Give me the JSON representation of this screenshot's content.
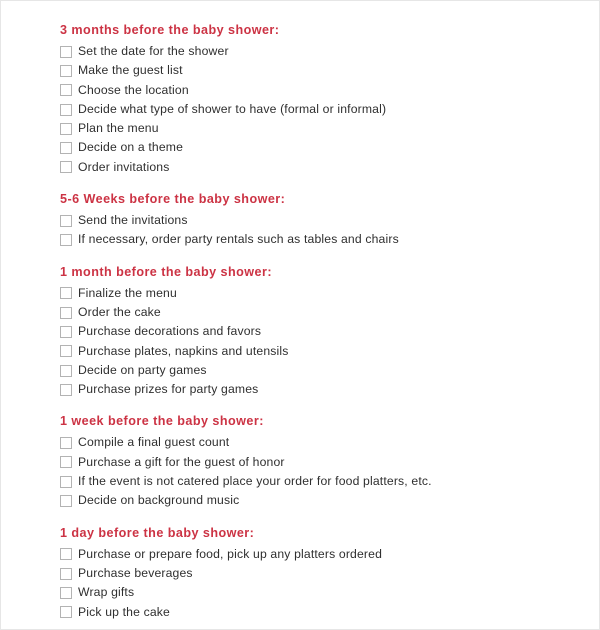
{
  "document": {
    "type": "baby-shower-planning-checklist",
    "accent_color": "#cc3344",
    "text_color": "#2f2f2f",
    "checkbox_border_color": "#b3b3b3",
    "page_border_color": "#e6e6e6",
    "background_color": "#ffffff"
  },
  "sections": [
    {
      "heading": "3 months before the baby shower:",
      "items": [
        "Set the date for the shower",
        "Make the guest list",
        "Choose the location",
        "Decide what type of shower to have (formal or informal)",
        "Plan the menu",
        "Decide on a theme",
        "Order invitations"
      ]
    },
    {
      "heading": "5-6 Weeks before the baby shower:",
      "items": [
        "Send the invitations",
        "If necessary, order party rentals such as tables and chairs"
      ]
    },
    {
      "heading": "1 month before the baby shower:",
      "items": [
        "Finalize the menu",
        "Order the cake",
        "Purchase decorations and favors",
        "Purchase plates, napkins and utensils",
        "Decide on party games",
        "Purchase prizes for party games"
      ]
    },
    {
      "heading": "1 week before the baby shower:",
      "items": [
        "Compile a final guest count",
        "Purchase a gift for the guest of honor",
        "If the event is not catered place your order for food platters, etc.",
        "Decide on background music"
      ]
    },
    {
      "heading": "1 day before the baby shower:",
      "items": [
        "Purchase or prepare food, pick up any platters ordered",
        "Purchase beverages",
        "Wrap gifts",
        "Pick up the cake"
      ]
    }
  ]
}
